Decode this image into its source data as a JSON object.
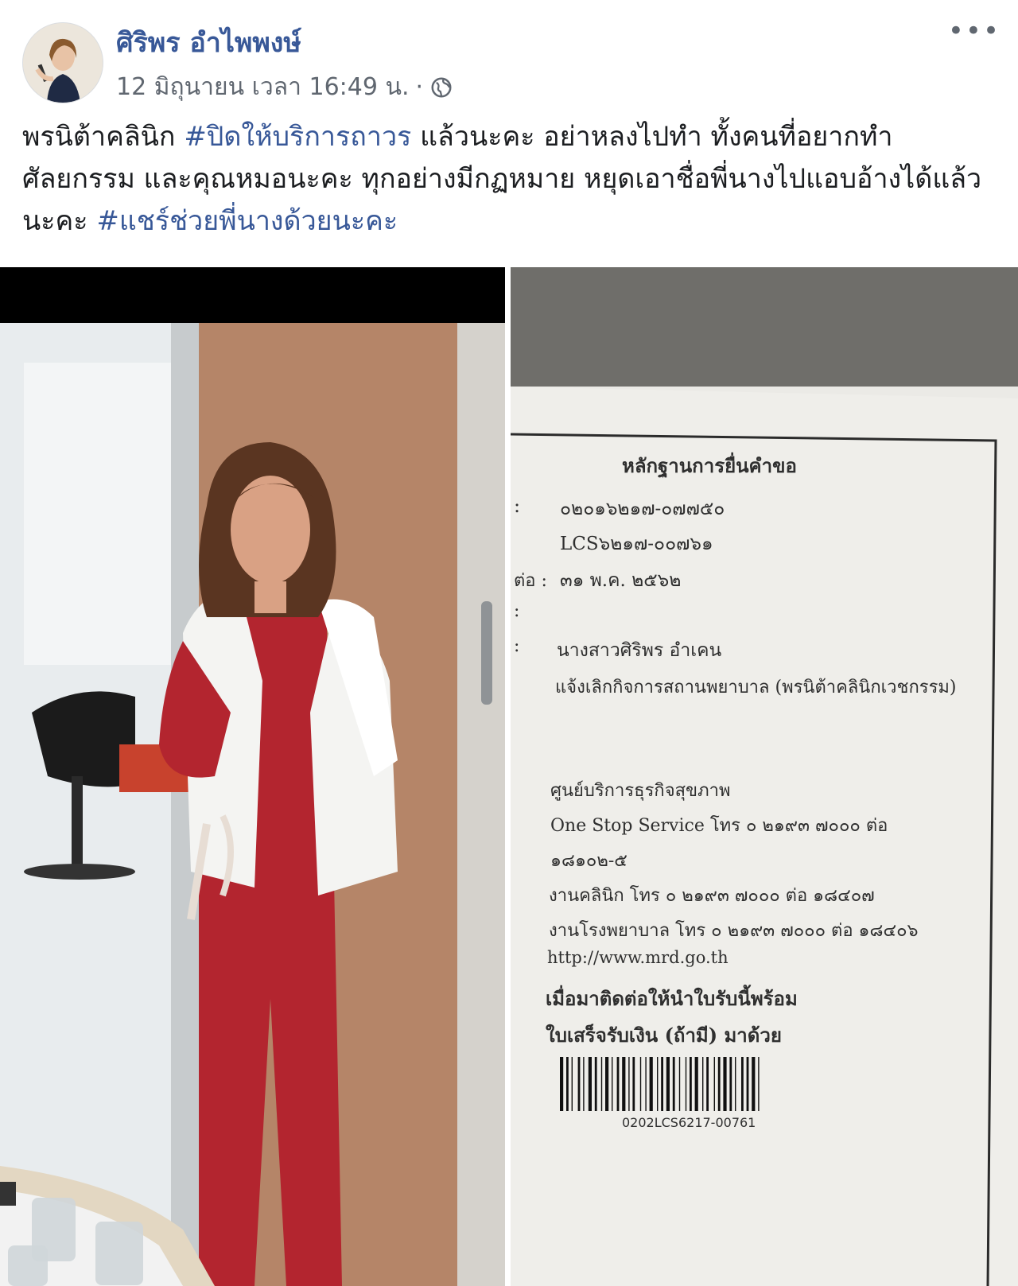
{
  "post": {
    "author_name": "ศิริพร อำไพพงษ์",
    "timestamp": "12 มิถุนายน เวลา 16:49 น.",
    "separator": "·",
    "privacy_icon": "globe-icon",
    "more_icon": "more-horizontal-icon",
    "more_label": "•••",
    "caption": {
      "seg1": "พรนิต้าคลินิก ",
      "tag1": "#ปิดให้บริการถาวร",
      "seg2": " แล้วนะคะ อย่าหลงไปทำ ทั้งคนที่อยากทำศัลยกรรม และคุณหมอนะคะ ทุกอย่างมีกฏหมาย หยุดเอาชื่อพี่นางไปแอบอ้างได้แล้วนะคะ ",
      "tag2": "#แชร์ช่วยพี่นางด้วยนะคะ"
    }
  },
  "receipt": {
    "title": "หลักฐานการยื่นคำขอ",
    "line_number": "๐๒๐๑๖๒๑๗-๐๗๗๕๐",
    "line_code": "LCS๖๒๑๗-๐๐๗๖๑",
    "line_date_prefix": "ต่อ :",
    "line_date": "๓๑ พ.ค. ๒๕๖๒",
    "line_blank": ":",
    "line_name_prefix": ":",
    "line_name": "นางสาวศิริพร  อำเคน",
    "line_subject": "แจ้งเลิกกิจการสถานพยาบาล (พรนิต้าคลินิกเวชกรรม)",
    "center": "ศูนย์บริการธุรกิจสุขภาพ",
    "contact1": "One Stop Service โทร ๐ ๒๑๙๓ ๗๐๐๐ ต่อ",
    "contact1b": "๑๘๑๐๒-๕",
    "contact2": "งานคลินิก โทร ๐ ๒๑๙๓ ๗๐๐๐ ต่อ ๑๘๔๐๗",
    "contact3": "งานโรงพยาบาล โทร ๐ ๒๑๙๓ ๗๐๐๐ ต่อ ๑๘๔๐๖",
    "url": "http://www.mrd.go.th",
    "notice1": "เมื่อมาติดต่อให้นำใบรับนี้พร้อม",
    "notice2": "ใบเสร็จรับเงิน (ถ้ามี) มาด้วย",
    "barcode_text": "0202LCS6217-00761"
  }
}
